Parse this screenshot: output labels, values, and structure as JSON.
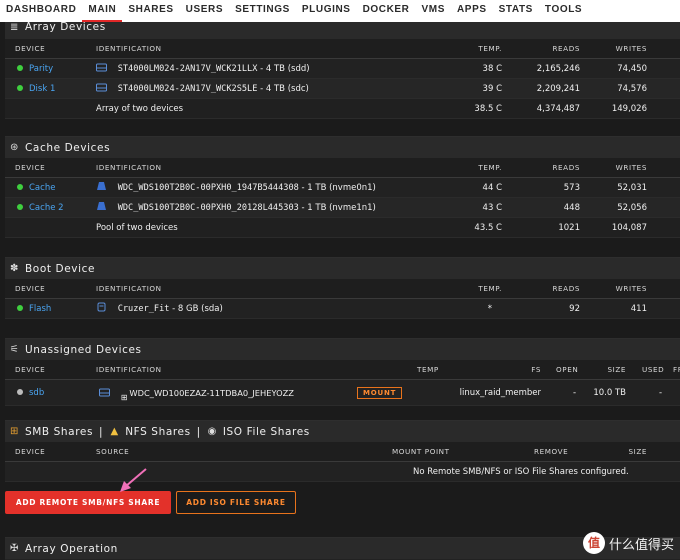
{
  "nav": {
    "tabs": [
      "DASHBOARD",
      "MAIN",
      "SHARES",
      "USERS",
      "SETTINGS",
      "PLUGINS",
      "DOCKER",
      "VMS",
      "APPS",
      "STATS",
      "TOOLS"
    ],
    "active": "MAIN"
  },
  "array": {
    "title": "Array Devices",
    "headers": {
      "device": "DEVICE",
      "identification": "IDENTIFICATION",
      "temp": "TEMP.",
      "reads": "READS",
      "writes": "WRITES"
    },
    "rows": [
      {
        "device": "Parity",
        "id": "ST4000LM024-2AN17V_WCK21LLX",
        "size": " - 4 TB (sdd)",
        "temp": "38 C",
        "reads": "2,165,246",
        "writes": "74,450"
      },
      {
        "device": "Disk 1",
        "id": "ST4000LM024-2AN17V_WCK2S5LE",
        "size": " - 4 TB (sdc)",
        "temp": "39 C",
        "reads": "2,209,241",
        "writes": "74,576"
      }
    ],
    "total": {
      "label": "Array of two devices",
      "temp": "38.5 C",
      "reads": "4,374,487",
      "writes": "149,026"
    }
  },
  "cache": {
    "title": "Cache Devices",
    "headers": {
      "device": "DEVICE",
      "identification": "IDENTIFICATION",
      "temp": "TEMP.",
      "reads": "READS",
      "writes": "WRITES"
    },
    "rows": [
      {
        "device": "Cache",
        "id": "WDC_WDS100T2B0C-00PXH0_1947B5444308",
        "size": " - 1 TB (nvme0n1)",
        "temp": "44 C",
        "reads": "573",
        "writes": "52,031"
      },
      {
        "device": "Cache 2",
        "id": "WDC_WDS100T2B0C-00PXH0_20128L445303",
        "size": " - 1 TB (nvme1n1)",
        "temp": "43 C",
        "reads": "448",
        "writes": "52,056"
      }
    ],
    "total": {
      "label": "Pool of two devices",
      "temp": "43.5 C",
      "reads": "1021",
      "writes": "104,087"
    }
  },
  "boot": {
    "title": "Boot Device",
    "headers": {
      "device": "DEVICE",
      "identification": "IDENTIFICATION",
      "temp": "TEMP.",
      "reads": "READS",
      "writes": "WRITES"
    },
    "rows": [
      {
        "device": "Flash",
        "id": "Cruzer_Fit",
        "size": " - 8 GB (sda)",
        "temp": "*",
        "reads": "92",
        "writes": "411"
      }
    ]
  },
  "unassigned": {
    "title": "Unassigned Devices",
    "headers": {
      "device": "DEVICE",
      "identification": "IDENTIFICATION",
      "temp": "TEMP",
      "fs": "FS",
      "open": "OPEN",
      "size": "SIZE",
      "used": "USED",
      "free": "FR"
    },
    "rows": [
      {
        "device": "sdb",
        "id": "WDC_WD100EZAZ-11TDBA0_JEHEYOZZ",
        "mount": "MOUNT",
        "fs": "linux_raid_member",
        "open": "-",
        "size": "10.0 TB",
        "used": "-"
      }
    ]
  },
  "shares": {
    "title_smb": "SMB Shares",
    "sep1": "|",
    "title_nfs": "NFS Shares",
    "sep2": "|",
    "title_iso": "ISO File Shares",
    "headers": {
      "device": "DEVICE",
      "source": "SOURCE",
      "mount_point": "MOUNT POINT",
      "remove": "REMOVE",
      "size": "SIZE"
    },
    "empty": "No Remote SMB/NFS or ISO File Shares configured.",
    "btn_add_remote": "ADD REMOTE SMB/NFS SHARE",
    "btn_add_iso": "ADD ISO FILE SHARE"
  },
  "array_op": {
    "title": "Array Operation"
  },
  "watermark": {
    "icon": "值",
    "text": "什么值得买"
  },
  "colors": {
    "accent_red": "#e3312a",
    "accent_orange": "#e8731c",
    "link_blue": "#4aa4f0",
    "status_green": "#3fcf3f"
  }
}
